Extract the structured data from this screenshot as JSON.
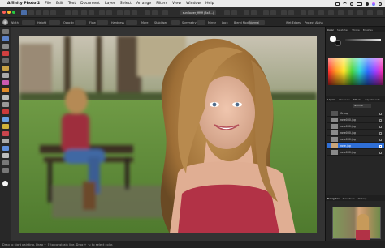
{
  "menubar": {
    "app_name": "Affinity Photo 2",
    "items": [
      "File",
      "Edit",
      "Text",
      "Document",
      "Layer",
      "Select",
      "Arrange",
      "Filters",
      "View",
      "Window",
      "Help"
    ]
  },
  "toolbar": {
    "document_title": "sunflower_ffffff (8x8...)"
  },
  "context": {
    "width_label": "Width",
    "height_label": "Height",
    "opacity_label": "Opacity",
    "flow_label": "Flow",
    "hardness_label": "Hardness",
    "more_label": "More",
    "stabiliser_label": "Stabiliser",
    "symmetry_label": "Symmetry",
    "mirror_label": "Mirror",
    "lock_label": "Lock",
    "blend_label": "Blend Mode",
    "blend_value": "Normal",
    "wet_label": "Wet Edges",
    "protect_label": "Protect Alpha"
  },
  "panel": {
    "top_tabs": [
      "Color",
      "Swatches",
      "Stroke",
      "Brushes"
    ],
    "layer_tabs": [
      "Layers",
      "Channels",
      "Effects",
      "Adjustments"
    ],
    "blend_value": "Normal",
    "layers": [
      "Group",
      "rose000.jpg",
      "rose000.jpg",
      "rose000.jpg",
      "rose000.jpg",
      "rose.jpg",
      "rose000.jpg"
    ],
    "bottom_tabs": [
      "Navigator",
      "Transform",
      "History"
    ]
  },
  "status": {
    "text": "Drag to start painting. Drag + ⇧ to constrain line. Drag + ⌥ to select color."
  },
  "colors": {
    "accent": "#2f6fd6",
    "panel_bg": "#262626",
    "canvas_bg": "#333333"
  }
}
